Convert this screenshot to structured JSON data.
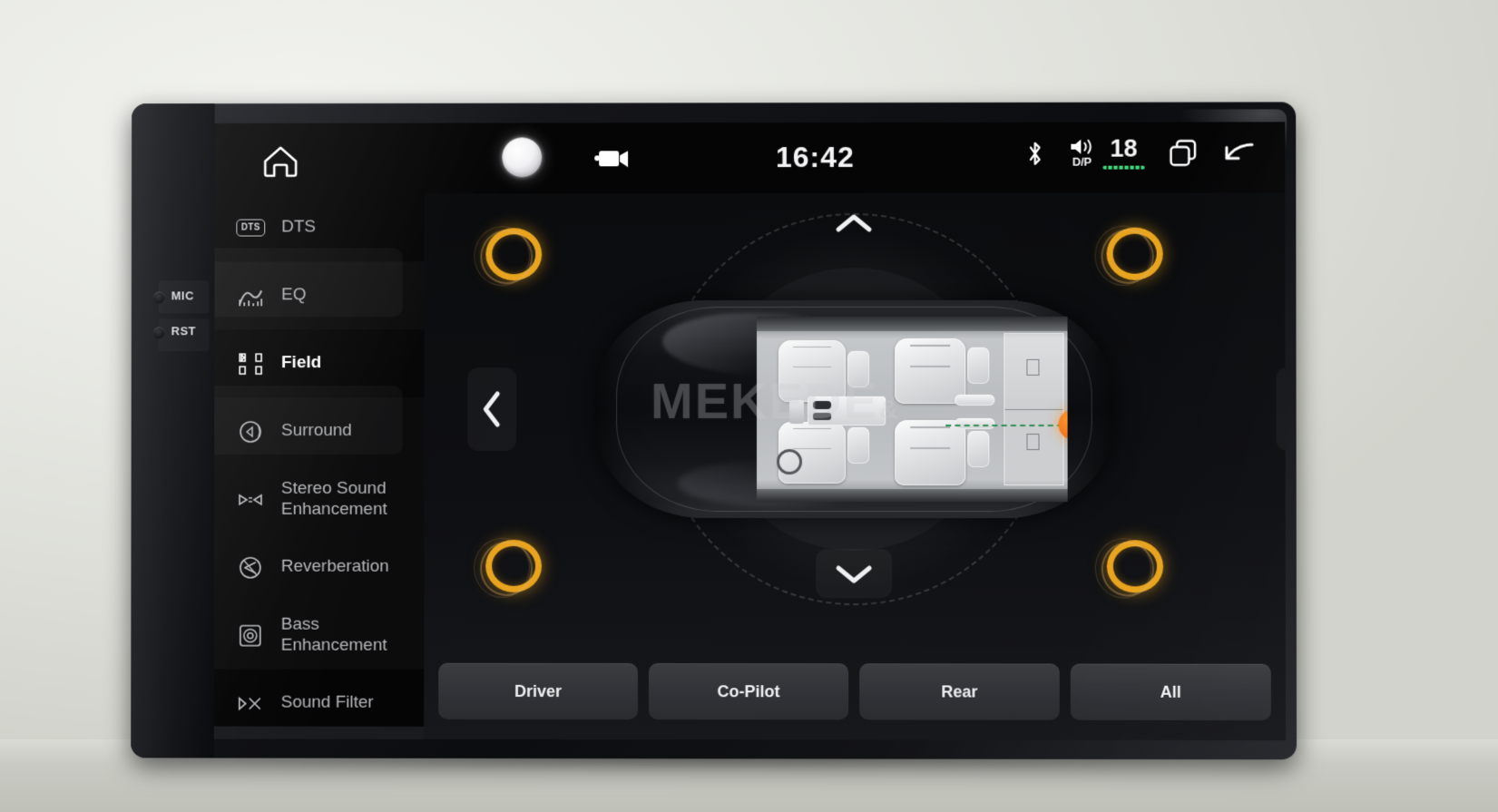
{
  "device": {
    "bezel_buttons": [
      {
        "name": "MIC",
        "label": "MIC"
      },
      {
        "name": "RST",
        "label": "RST"
      }
    ]
  },
  "statusbar": {
    "home_icon": "home-icon",
    "voice_orb_icon": "voice-assistant-orb",
    "camera_icon": "dashcam-icon",
    "clock": "16:42",
    "bluetooth_icon": "bluetooth-icon",
    "speaker_icon": "speaker-icon",
    "audio_source_label": "D/P",
    "volume_value": "18",
    "recents_icon": "recent-apps-icon",
    "back_icon": "back-arrow-icon"
  },
  "sidebar": {
    "items": [
      {
        "label": "DTS",
        "icon": "dts-logo-icon",
        "active": false
      },
      {
        "label": "EQ",
        "icon": "equalizer-icon",
        "active": false
      },
      {
        "label": "Field",
        "icon": "sound-field-icon",
        "active": true
      },
      {
        "label": "Surround",
        "icon": "surround-icon",
        "active": false
      },
      {
        "label": "Stereo Sound Enhancement",
        "icon": "stereo-enhance-icon",
        "active": false
      },
      {
        "label": "Reverberation",
        "icon": "reverberation-icon",
        "active": false
      },
      {
        "label": "Bass Enhancement",
        "icon": "bass-enhance-icon",
        "active": false
      },
      {
        "label": "Sound Filter",
        "icon": "sound-filter-icon",
        "active": false
      }
    ]
  },
  "stage": {
    "watermark": "MEKEDE",
    "watermark_suffix": "&",
    "nav": {
      "up": "chevron-up-icon",
      "down": "chevron-down-icon",
      "left": "chevron-left-icon",
      "right": "chevron-right-icon"
    },
    "position_marker": "sound-position-dot",
    "speakers": [
      {
        "name": "front-left-speaker",
        "state": "active"
      },
      {
        "name": "front-right-speaker",
        "state": "active"
      },
      {
        "name": "rear-left-speaker",
        "state": "active"
      },
      {
        "name": "rear-right-speaker",
        "state": "active"
      }
    ],
    "accent_color": "#f2761a",
    "speaker_color": "#e8a41e",
    "axis_color": "#2f8f57"
  },
  "presets": {
    "buttons": [
      {
        "label": "Driver"
      },
      {
        "label": "Co-Pilot"
      },
      {
        "label": "Rear"
      },
      {
        "label": "All"
      }
    ]
  }
}
